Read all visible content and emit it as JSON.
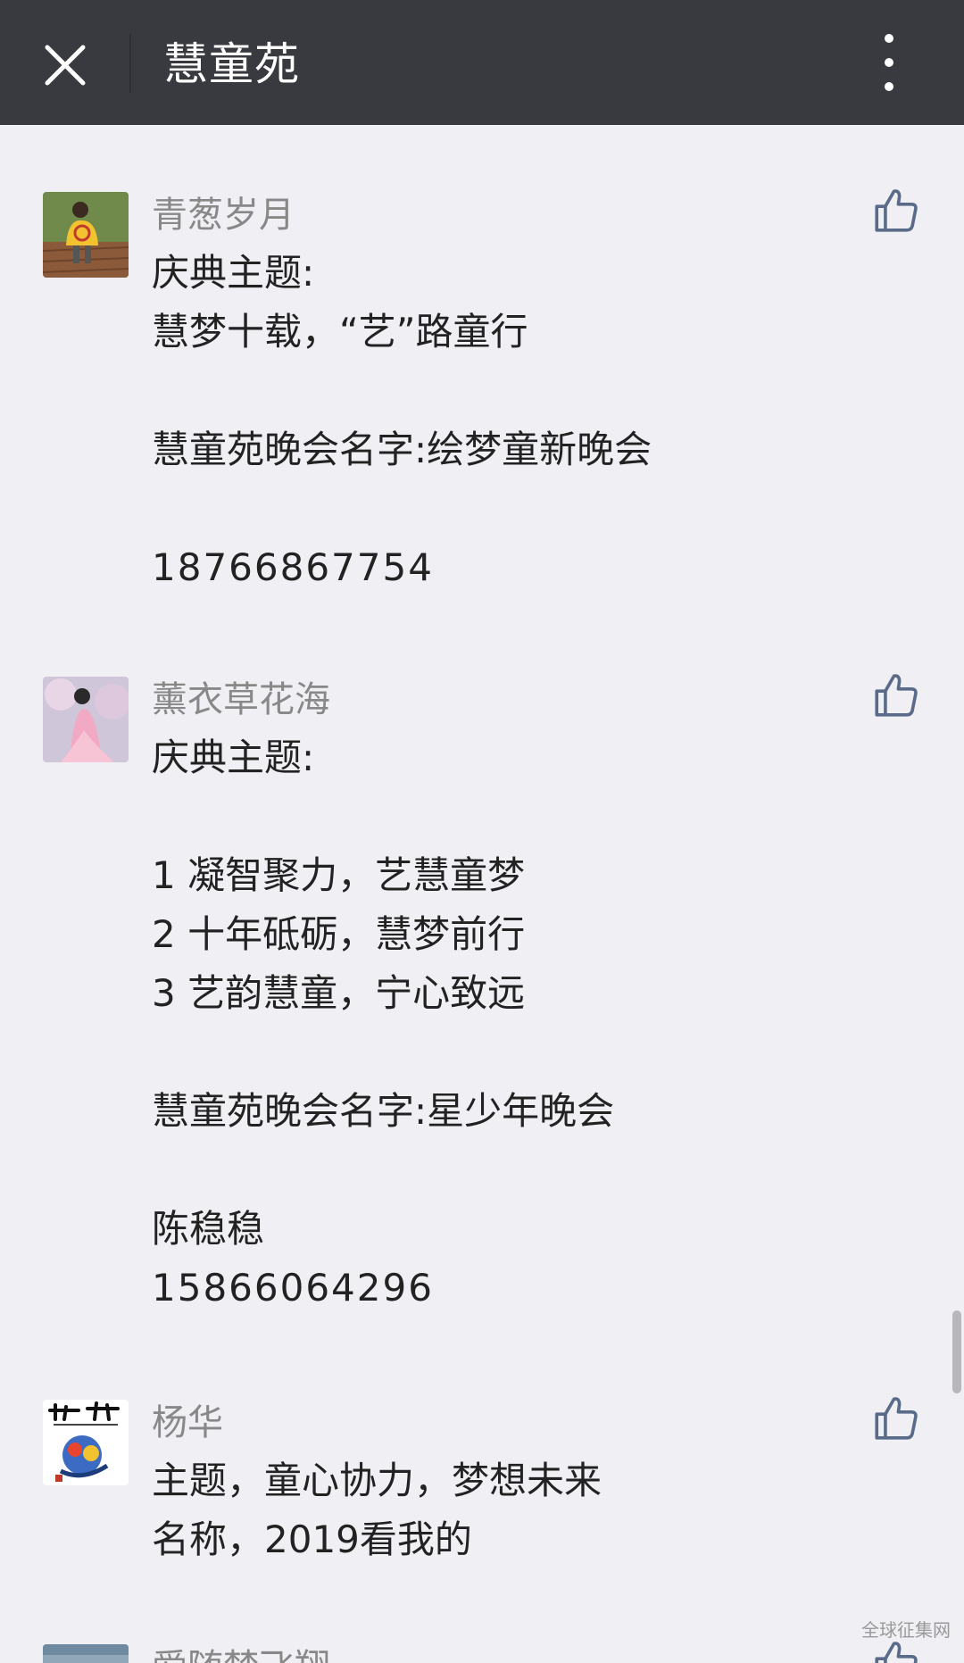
{
  "header": {
    "title": "慧童苑",
    "close_icon": "close-icon",
    "more_icon": "more-vertical-icon"
  },
  "comments": [
    {
      "nickname": "青葱岁月",
      "avatar_icon": "avatar-child-yellow-shirt",
      "lines": [
        "庆典主题:",
        "慧梦十载，“艺”路童行",
        "",
        "慧童苑晚会名字:绘梦童新晚会",
        "",
        "18766867754"
      ]
    },
    {
      "nickname": "薰衣草花海",
      "avatar_icon": "avatar-woman-pink-dress",
      "lines": [
        "庆典主题:",
        "",
        "1 凝智聚力，艺慧童梦",
        "2 十年砥砺，慧梦前行",
        "3 艺韵慧童，宁心致远",
        "",
        "慧童苑晚会名字:星少年晚会",
        "",
        "陈稳稳",
        "15866064296"
      ]
    },
    {
      "nickname": "杨华",
      "avatar_icon": "avatar-calligraphy-art",
      "lines": [
        "主题，童心协力，梦想未来",
        "名称，2019看我的"
      ]
    },
    {
      "nickname": "爱随梦飞翔",
      "avatar_icon": "avatar-blue",
      "lines": []
    }
  ],
  "like_icon": "thumbs-up-icon",
  "watermark": "全球征集网",
  "colors": {
    "topbar": "#393a3f",
    "background": "#efeff4",
    "nickname": "#888888",
    "content": "#222222",
    "like_icon": "#5a6b8a"
  }
}
